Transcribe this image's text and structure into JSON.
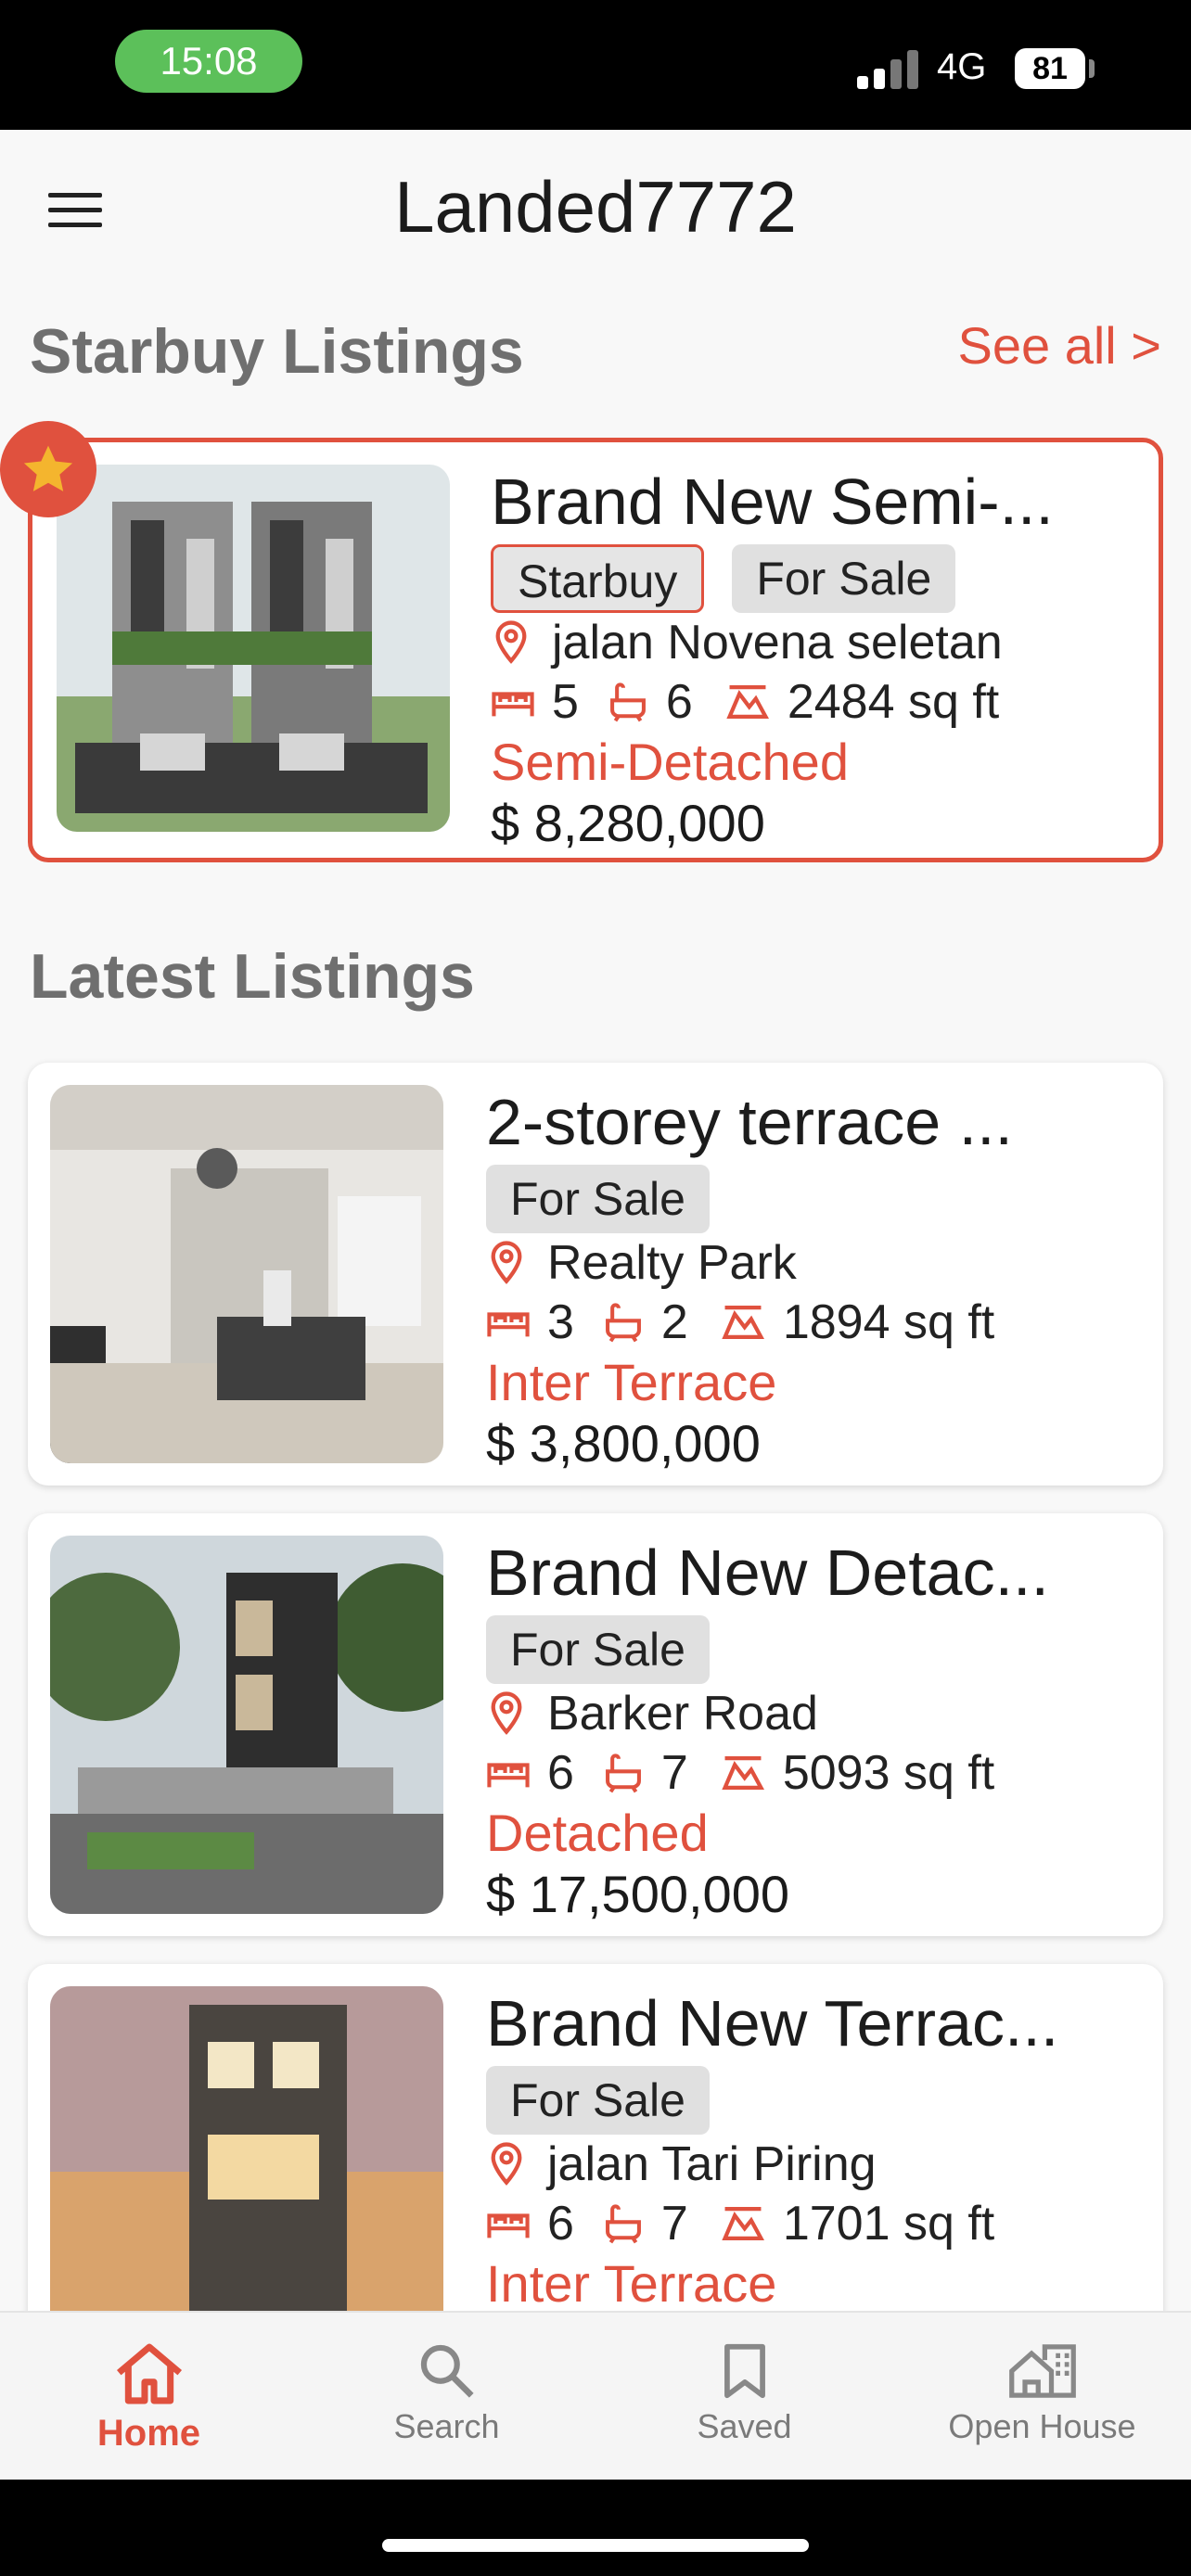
{
  "status": {
    "time": "15:08",
    "network": "4G",
    "battery": "81"
  },
  "header": {
    "title": "Landed7772"
  },
  "starbuy": {
    "section_title": "Starbuy Listings",
    "see_all": "See all >",
    "listing": {
      "title": "Brand New Semi-...",
      "badges": [
        "Starbuy",
        "For Sale"
      ],
      "location": "jalan Novena seletan",
      "beds": "5",
      "baths": "6",
      "area": "2484 sq ft",
      "type": "Semi-Detached",
      "price": "$ 8,280,000"
    }
  },
  "latest": {
    "section_title": "Latest Listings",
    "listings": [
      {
        "title": "2-storey terrace ...",
        "badge": "For Sale",
        "location": "Realty Park",
        "beds": "3",
        "baths": "2",
        "area": "1894 sq ft",
        "type": "Inter Terrace",
        "price": "$ 3,800,000"
      },
      {
        "title": "Brand New Detac...",
        "badge": "For Sale",
        "location": "Barker Road",
        "beds": "6",
        "baths": "7",
        "area": "5093 sq ft",
        "type": "Detached",
        "price": "$ 17,500,000"
      },
      {
        "title": "Brand New Terrac...",
        "badge": "For Sale",
        "location": "jalan Tari Piring",
        "beds": "6",
        "baths": "7",
        "area": "1701 sq ft",
        "type": "Inter Terrace",
        "price": ""
      }
    ]
  },
  "nav": {
    "items": [
      {
        "label": "Home",
        "icon": "home-icon",
        "active": true
      },
      {
        "label": "Search",
        "icon": "search-icon",
        "active": false
      },
      {
        "label": "Saved",
        "icon": "bookmark-icon",
        "active": false
      },
      {
        "label": "Open House",
        "icon": "open-house-icon",
        "active": false
      }
    ]
  },
  "colors": {
    "accent": "#e0513e",
    "status_green": "#5cc05a",
    "badge_bg": "#e0e0e0",
    "text": "#1c1c1c",
    "muted": "#6f6f6f"
  }
}
